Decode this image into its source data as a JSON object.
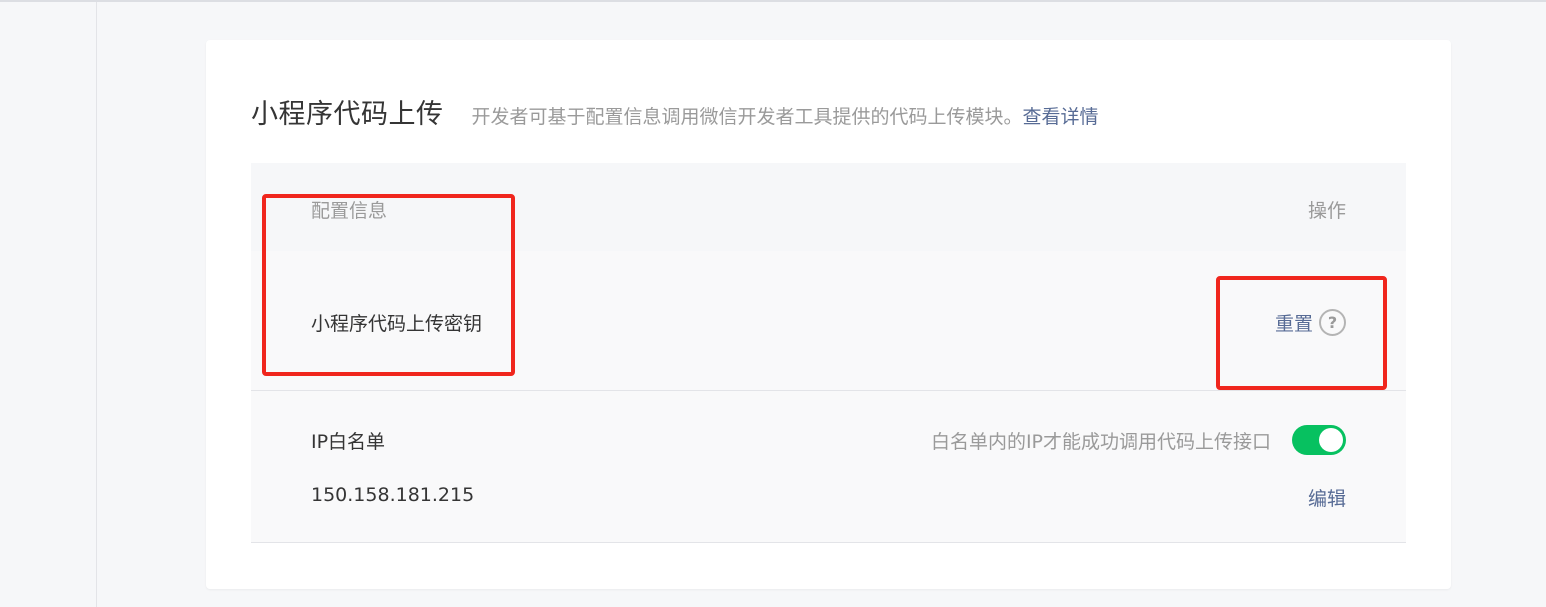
{
  "section": {
    "title": "小程序代码上传",
    "description": "开发者可基于配置信息调用微信开发者工具提供的代码上传模块。",
    "details_link": "查看详情"
  },
  "table": {
    "header_config": "配置信息",
    "header_action": "操作"
  },
  "secret_row": {
    "label": "小程序代码上传密钥",
    "reset_label": "重置",
    "help_glyph": "?"
  },
  "whitelist_row": {
    "label": "IP白名单",
    "hint": "白名单内的IP才能成功调用代码上传接口",
    "toggle_on": true,
    "ip": "150.158.181.215",
    "edit_label": "编辑"
  },
  "colors": {
    "accent_link": "#576b95",
    "toggle_on": "#07c160",
    "highlight_box": "#f0261d"
  }
}
